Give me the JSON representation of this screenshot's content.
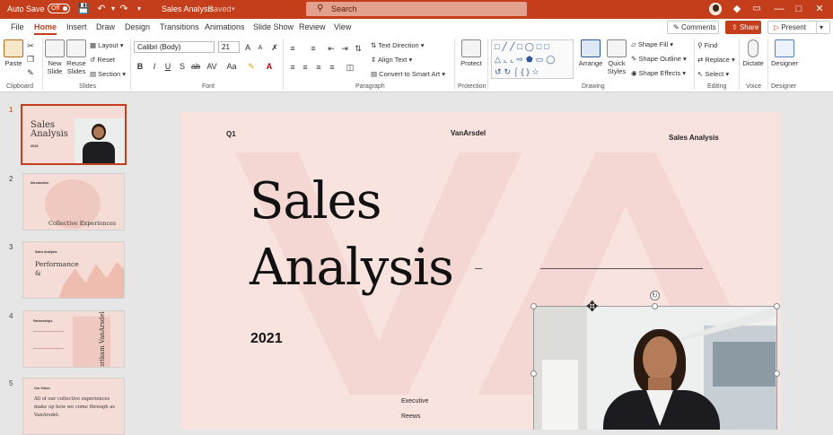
{
  "titlebar": {
    "autosave_label": "Auto Save",
    "autosave_state": "Off",
    "doc_title": "Sales Analysis",
    "doc_status": "Saved",
    "search_placeholder": "Search"
  },
  "menu": {
    "tabs": [
      "File",
      "Home",
      "Insert",
      "Draw",
      "Design",
      "Transitions",
      "Animations",
      "Slide Show",
      "Review",
      "View"
    ],
    "active_tab": "Home",
    "comments_label": "Comments",
    "share_label": "Share",
    "present_label": "Present"
  },
  "ribbon": {
    "clipboard": {
      "paste": "Paste",
      "label": "Clipboard"
    },
    "slides": {
      "new_slide": "New Slide",
      "reuse_slides": "Reuse Slides",
      "layout": "Layout",
      "reset": "Reset",
      "section": "Section",
      "label": "Slides"
    },
    "font": {
      "name": "Calibri (Body)",
      "size": "21",
      "label": "Font"
    },
    "paragraph": {
      "text_direction": "Text Direction",
      "align_text": "Align Text",
      "convert_smartart": "Convert to Smart Art",
      "label": "Paragraph"
    },
    "protection": {
      "protect": "Protect",
      "label": "Protection"
    },
    "drawing": {
      "arrange": "Arrange",
      "quick_styles": "Quick Styles",
      "shape_fill": "Shape Fill",
      "shape_outline": "Shape Outline",
      "shape_effects": "Shape Effects",
      "label": "Drawing"
    },
    "editing": {
      "find": "Find",
      "replace": "Replace",
      "select": "Select",
      "label": "Editing"
    },
    "voice": {
      "dictate": "Dictate",
      "label": "Voice"
    },
    "designer": {
      "designer": "Designer",
      "label": "Designer"
    }
  },
  "thumbnails": [
    {
      "num": "1",
      "title": "Sales Analysis",
      "sub": "2021"
    },
    {
      "num": "2",
      "heading": "Introduction",
      "title": "Collective Experiences"
    },
    {
      "num": "3",
      "heading": "Sales Analysis",
      "title": "Performance &"
    },
    {
      "num": "4",
      "heading": "Partnerships",
      "vertical": "Fabrikam VanArsdel"
    },
    {
      "num": "5",
      "heading": "Our Vision",
      "title": "All of our collective experiences make up how we come through as VanArsdel."
    }
  ],
  "slide": {
    "q1": "Q1",
    "brand": "VanArsdel",
    "header_right": "Sales Analysis",
    "title_line1": "Sales",
    "title_line2": "Analysis",
    "year": "2021",
    "item1": "Executive",
    "item2": "Reews"
  }
}
